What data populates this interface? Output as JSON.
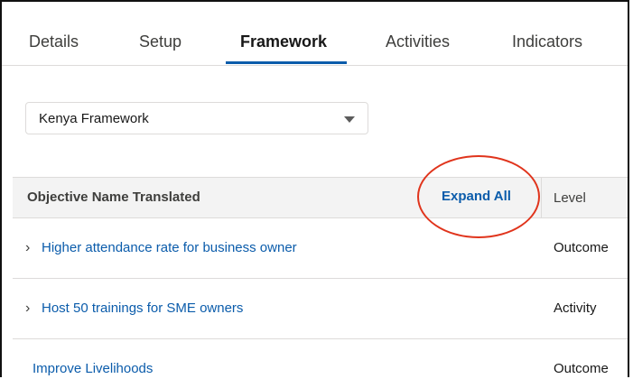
{
  "tabs": [
    {
      "label": "Details"
    },
    {
      "label": "Setup"
    },
    {
      "label": "Framework"
    },
    {
      "label": "Activities"
    },
    {
      "label": "Indicators"
    }
  ],
  "active_tab": "Framework",
  "framework_select": {
    "value": "Kenya Framework"
  },
  "table": {
    "header_name": "Objective Name Translated",
    "expand_all_label": "Expand All",
    "header_level": "Level",
    "rows": [
      {
        "name": "Higher attendance rate for business owner",
        "level": "Outcome",
        "expandable": true
      },
      {
        "name": "Host 50 trainings for SME owners",
        "level": "Activity",
        "expandable": true
      },
      {
        "name": "Improve Livelihoods",
        "level": "Outcome",
        "expandable": false
      }
    ]
  },
  "annotation_color": "#e0341c",
  "link_color": "#0b5cab"
}
